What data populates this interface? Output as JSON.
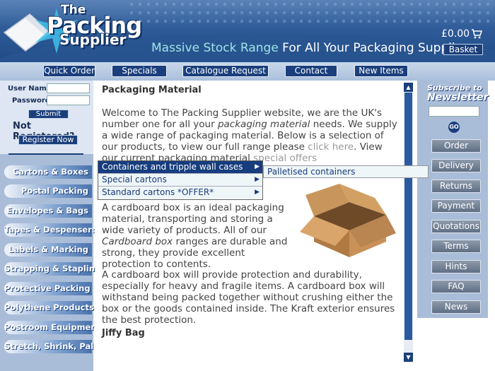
{
  "header": {
    "logo": {
      "the": "The",
      "packing": "Packing",
      "supplier": "Supplier"
    },
    "tagline_part1": "Massive Stock Range",
    "tagline_part2": " For All Your Packaging Supplies",
    "price": "£0.00",
    "basket_label": "Basket",
    "colors": {
      "accent": "#1b3f7c",
      "tagline": "#9fe3e6"
    }
  },
  "nav": [
    {
      "label": "Quick Order"
    },
    {
      "label": "Specials"
    },
    {
      "label": "Catalogue Request"
    },
    {
      "label": "Contact"
    },
    {
      "label": "New Items"
    }
  ],
  "login": {
    "username_label": "User Name",
    "password_label": "Password",
    "submit_label": "Submit",
    "not_registered": "Not Registered?",
    "register_label": "Register Now"
  },
  "categories": [
    {
      "label": "Cartons & Boxes"
    },
    {
      "label": "Postal Packing"
    },
    {
      "label": "Envelopes & Bags"
    },
    {
      "label": "Tapes & Despensers"
    },
    {
      "label": "Labels & Marking"
    },
    {
      "label": "Strapping & Stapling"
    },
    {
      "label": "Protective Packing"
    },
    {
      "label": "Polythene Products"
    },
    {
      "label": "Postroom Equipment"
    },
    {
      "label": "Stretch, Shrink, Pallet"
    }
  ],
  "main": {
    "heading": "Packaging Material",
    "intro_1": "Welcome to The Packing Supplier website, we are the UK's number one for all your ",
    "intro_em": "packaging material",
    "intro_2": " needs. We supply a wide range of packaging material. Below is a selection of our products, to view our full range please ",
    "intro_link": "click here",
    "intro_3": ". View our current packaging material ",
    "intro_link2": "special offers",
    "para2_1": "A cardboard box is an ideal packaging material, transporting and storing a wide variety of products. All of our ",
    "para2_em": "Cardboard box",
    "para2_2": " ranges are durable and strong, they provide excellent protection to contents.",
    "para3": "A cardboard box will provide protection and durability, especially for heavy and fragile items. A cardboard box will withstand being packed together without crushing either the box or the goods contained inside. The Kraft exterior ensures the best protection.",
    "jiffy_heading": "Jiffy Bag"
  },
  "dropdown": {
    "items": [
      {
        "label": "Containers and tripple wall cases"
      },
      {
        "label": "Special cartons"
      },
      {
        "label": "Standard cartons *OFFER*"
      }
    ],
    "submenu_item": "Palletised containers"
  },
  "newsletter": {
    "subscribe_label": "Subscribe to",
    "newsletter_label": "Newsletter",
    "go_label": "GO"
  },
  "side_buttons": [
    {
      "label": "Order"
    },
    {
      "label": "Delivery"
    },
    {
      "label": "Returns"
    },
    {
      "label": "Payment"
    },
    {
      "label": "Quotations"
    },
    {
      "label": "Terms"
    },
    {
      "label": "Hints"
    },
    {
      "label": "FAQ"
    },
    {
      "label": "News"
    }
  ],
  "icons": {
    "cart": "shopping-cart-icon",
    "scroll_up": "▲",
    "scroll_down": "▼",
    "submenu_arrow": "▶"
  }
}
